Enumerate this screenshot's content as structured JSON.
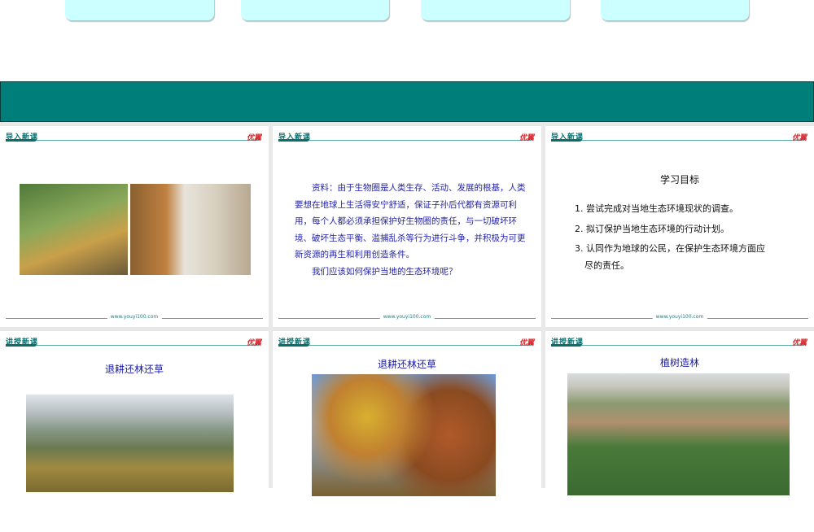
{
  "slides": [
    {
      "header": "导入新课",
      "logo": "优翼",
      "footer": "www.youyi100.com"
    },
    {
      "header": "导入新课",
      "logo": "优翼",
      "footer": "www.youyi100.com",
      "paragraphs": [
        "资料：由于生物圈是人类生存、活动、发展的根基，人类要想在地球上生活得安宁舒适，保证子孙后代都有资源可利用，每个人都必须承担保护好生物圈的责任，与一切破坏环境、破坏生态平衡、滥捕乱杀等行为进行斗争，并积极为可更新资源的再生和利用创造条件。",
        "我们应该如何保护当地的生态环境呢？"
      ]
    },
    {
      "header": "导入新课",
      "logo": "优翼",
      "footer": "www.youyi100.com",
      "title": "学习目标",
      "items": [
        "1. 尝试完成对当地生态环境现状的调查。",
        "2. 拟订保护当地生态环境的行动计划。",
        "3. 认同作为地球的公民，在保护生态环境方面应",
        "尽的责任。"
      ]
    },
    {
      "header": "讲授新课",
      "logo": "优翼",
      "title": "退耕还林还草"
    },
    {
      "header": "讲授新课",
      "logo": "优翼",
      "title": "退耕还林还草"
    },
    {
      "header": "讲授新课",
      "logo": "优翼",
      "title": "植树造林"
    }
  ],
  "colors": {
    "band": "#007e7a",
    "topbox": "#ccffff",
    "slide_text": "#2424a8"
  }
}
